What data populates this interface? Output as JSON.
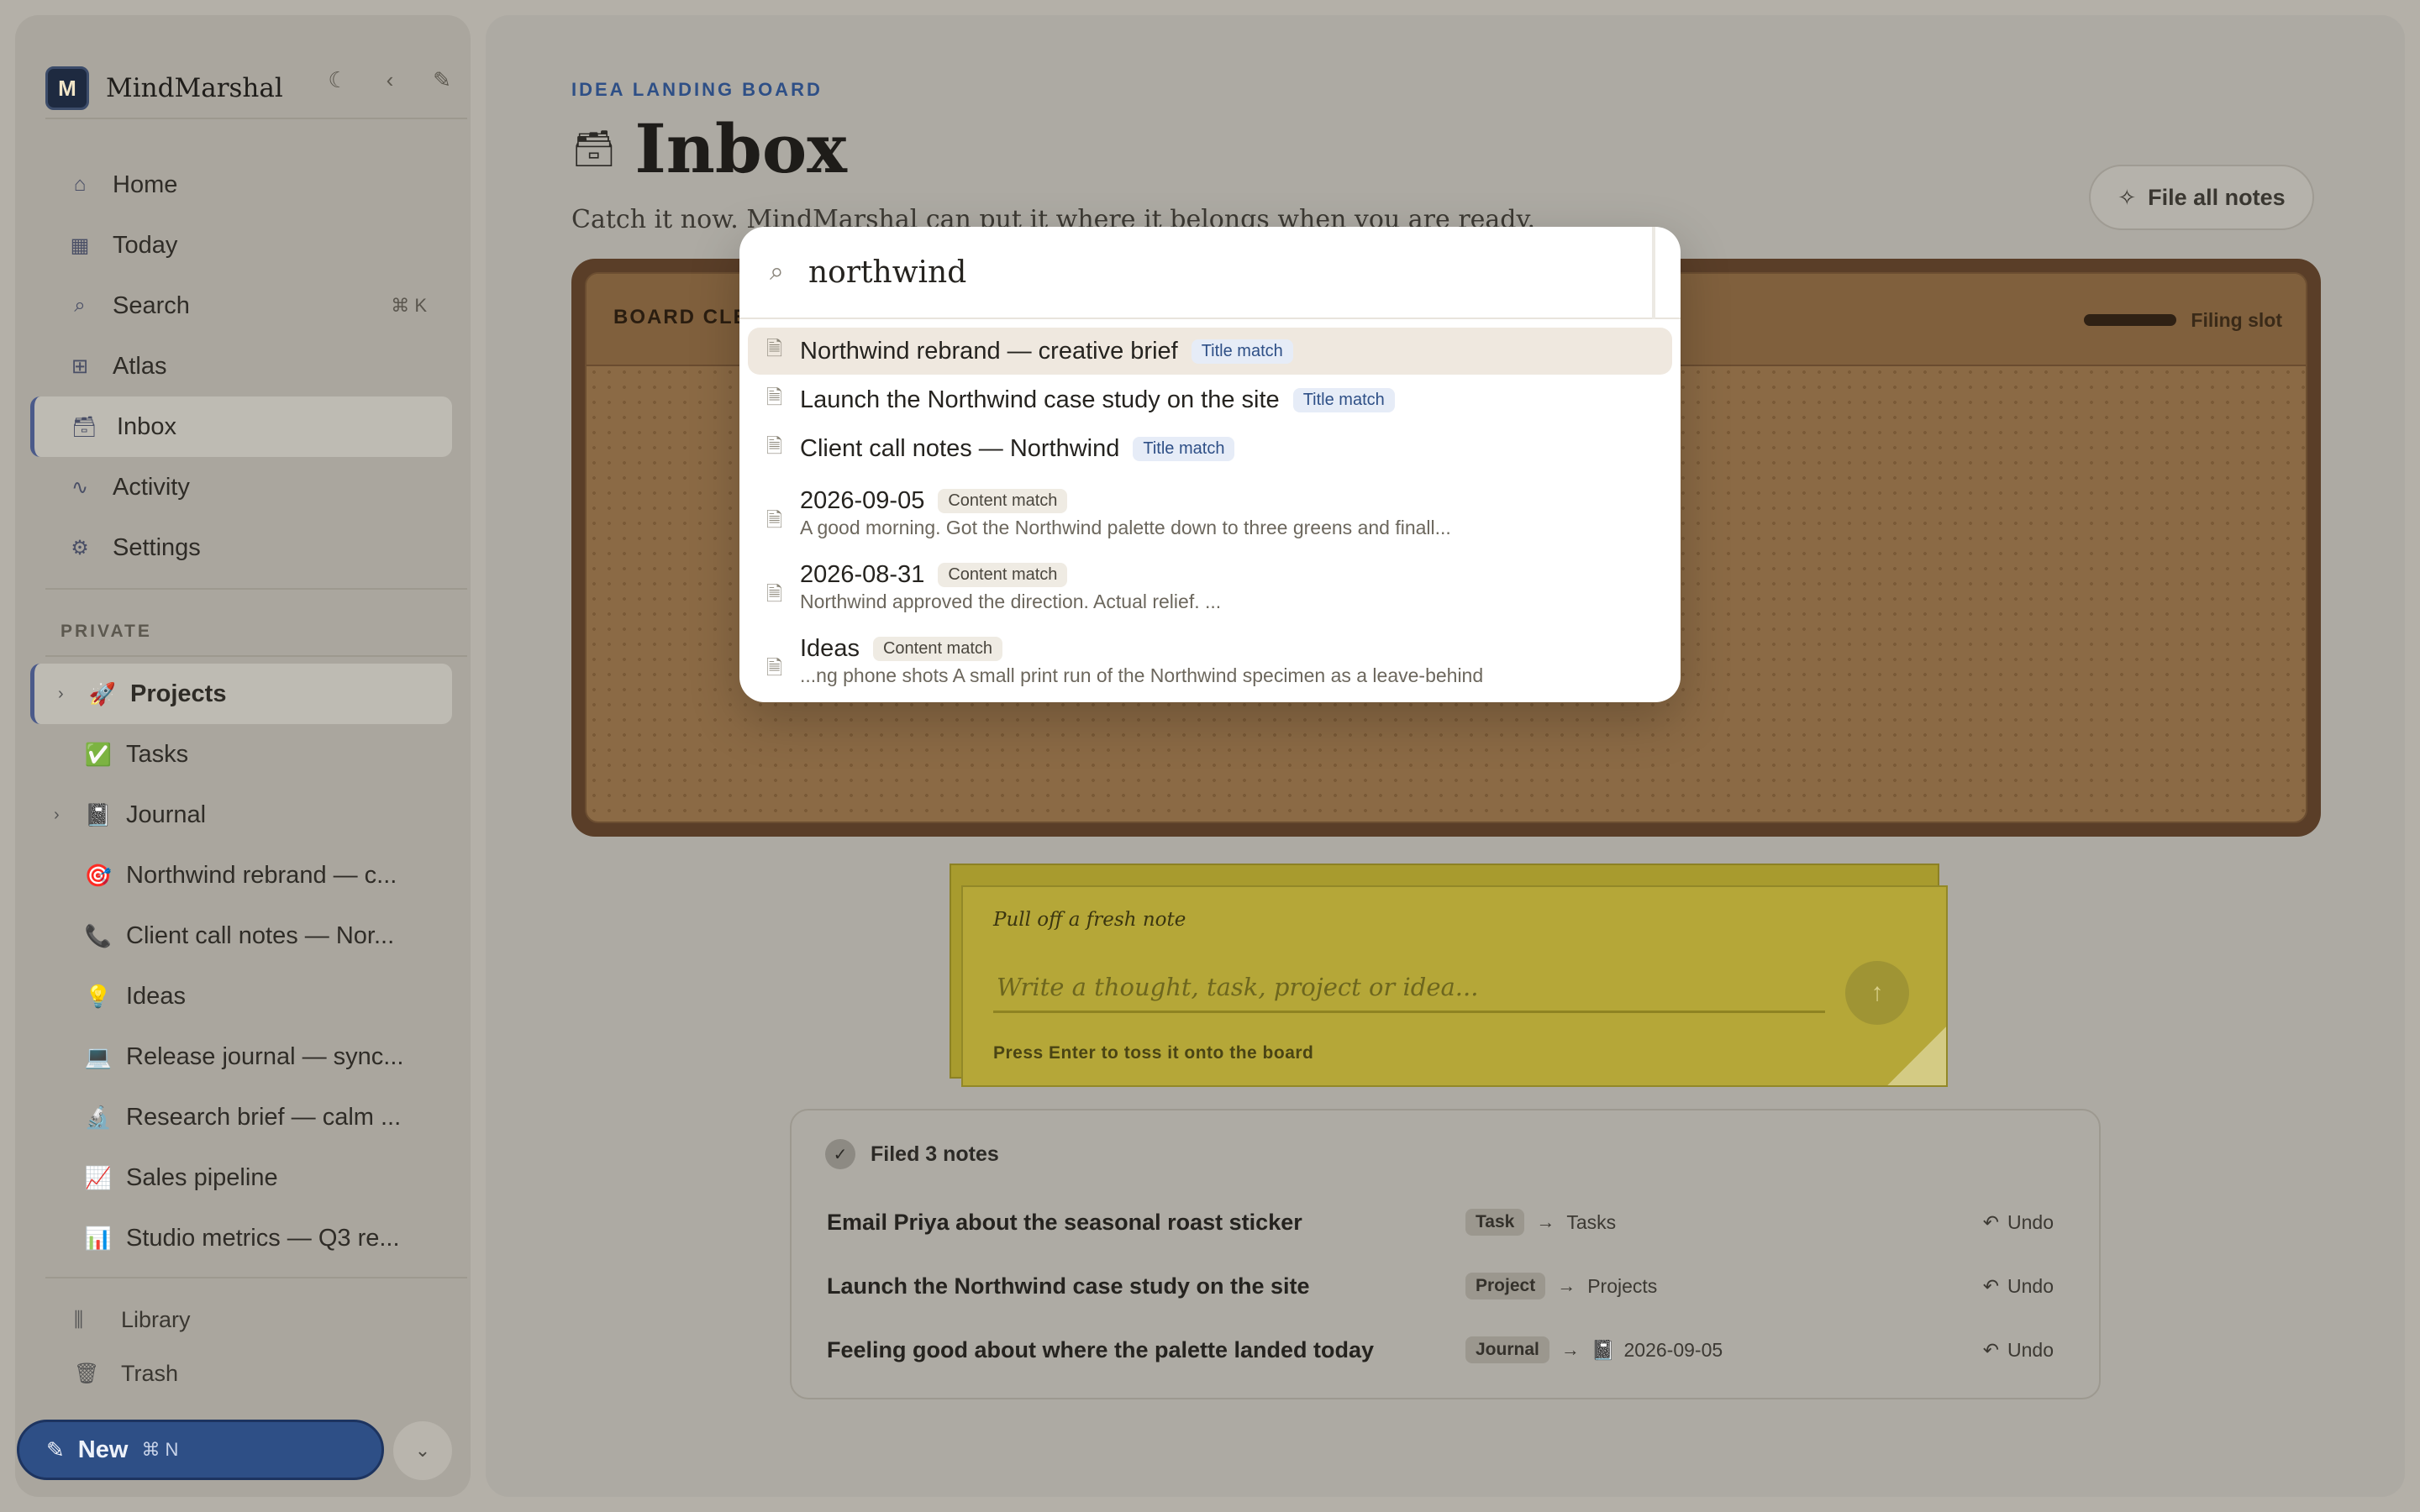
{
  "sidebar": {
    "brand": {
      "logo": "M",
      "name": "MindMarshal"
    },
    "tools": {
      "theme_icon": "moon-icon",
      "collapse_icon": "chevron-left-icon",
      "compose_icon": "pencil-icon"
    },
    "nav": [
      {
        "label": "Home",
        "icon": "home-icon",
        "glyph": "⌂"
      },
      {
        "label": "Today",
        "icon": "calendar-icon",
        "glyph": "▦"
      },
      {
        "label": "Search",
        "icon": "search-icon",
        "glyph": "⌕",
        "shortcut": "⌘ K"
      },
      {
        "label": "Atlas",
        "icon": "grid-icon",
        "glyph": "⊞"
      },
      {
        "label": "Inbox",
        "icon": "inbox-icon",
        "glyph": "🗃"
      },
      {
        "label": "Activity",
        "icon": "activity-icon",
        "glyph": "∿"
      },
      {
        "label": "Settings",
        "icon": "gear-icon",
        "glyph": "⚙"
      }
    ],
    "section_label": "PRIVATE",
    "tree": [
      {
        "label": "Projects",
        "emoji": "🚀",
        "expandable": true
      },
      {
        "label": "Tasks",
        "emoji": "✅",
        "expandable": false
      },
      {
        "label": "Journal",
        "emoji": "📓",
        "expandable": true
      },
      {
        "label": "Northwind rebrand — c...",
        "emoji": "🎯",
        "expandable": false
      },
      {
        "label": "Client call notes — Nor...",
        "emoji": "📞",
        "expandable": false
      },
      {
        "label": "Ideas",
        "emoji": "💡",
        "expandable": false
      },
      {
        "label": "Release journal — sync...",
        "emoji": "💻",
        "expandable": false
      },
      {
        "label": "Research brief — calm ...",
        "emoji": "🔬",
        "expandable": false
      },
      {
        "label": "Sales pipeline",
        "emoji": "📈",
        "expandable": false
      },
      {
        "label": "Studio metrics — Q3 re...",
        "emoji": "📊",
        "expandable": false
      }
    ],
    "bottom": [
      {
        "label": "Library",
        "icon": "library-icon",
        "glyph": "⫼"
      },
      {
        "label": "Trash",
        "icon": "trash-icon",
        "glyph": "🗑"
      }
    ],
    "new_button": {
      "label": "New",
      "shortcut": "⌘ N"
    }
  },
  "main": {
    "eyebrow": "IDEA LANDING BOARD",
    "title": "Inbox",
    "title_emoji": "🗃",
    "subtitle": "Catch it now. MindMarshal can put it where it belongs when you are ready.",
    "file_all_label": "File all notes",
    "board": {
      "title": "BOARD CLE",
      "slot_label": "Filing slot"
    },
    "sticky": {
      "label": "Pull off a fresh note",
      "placeholder": "Write a thought, task, project or idea...",
      "hint": "Press Enter to toss it onto the board"
    },
    "filed": {
      "heading": "Filed 3 notes",
      "rows": [
        {
          "title": "Email Priya about the seasonal roast sticker",
          "tag": "Task",
          "dest": "Tasks",
          "dest_emoji": "",
          "undo": "Undo"
        },
        {
          "title": "Launch the Northwind case study on the site",
          "tag": "Project",
          "dest": "Projects",
          "dest_emoji": "",
          "undo": "Undo"
        },
        {
          "title": "Feeling good about where the palette landed today",
          "tag": "Journal",
          "dest": "2026-09-05",
          "dest_emoji": "📓",
          "undo": "Undo"
        }
      ]
    }
  },
  "palette": {
    "query": "northwind",
    "results": [
      {
        "name": "Northwind rebrand — creative brief",
        "badge": "Title match",
        "kind": "title",
        "snippet": ""
      },
      {
        "name": "Launch the Northwind case study on the site",
        "badge": "Title match",
        "kind": "title",
        "snippet": ""
      },
      {
        "name": "Client call notes — Northwind",
        "badge": "Title match",
        "kind": "title",
        "snippet": ""
      },
      {
        "name": "2026-09-05",
        "badge": "Content match",
        "kind": "content",
        "snippet": "A good morning. Got the Northwind palette down to three greens and finall..."
      },
      {
        "name": "2026-08-31",
        "badge": "Content match",
        "kind": "content",
        "snippet": "Northwind approved the direction. Actual relief. ..."
      },
      {
        "name": "Ideas",
        "badge": "Content match",
        "kind": "content",
        "snippet": "...ng phone shots A small print run of the Northwind specimen as a leave-behind"
      }
    ]
  }
}
